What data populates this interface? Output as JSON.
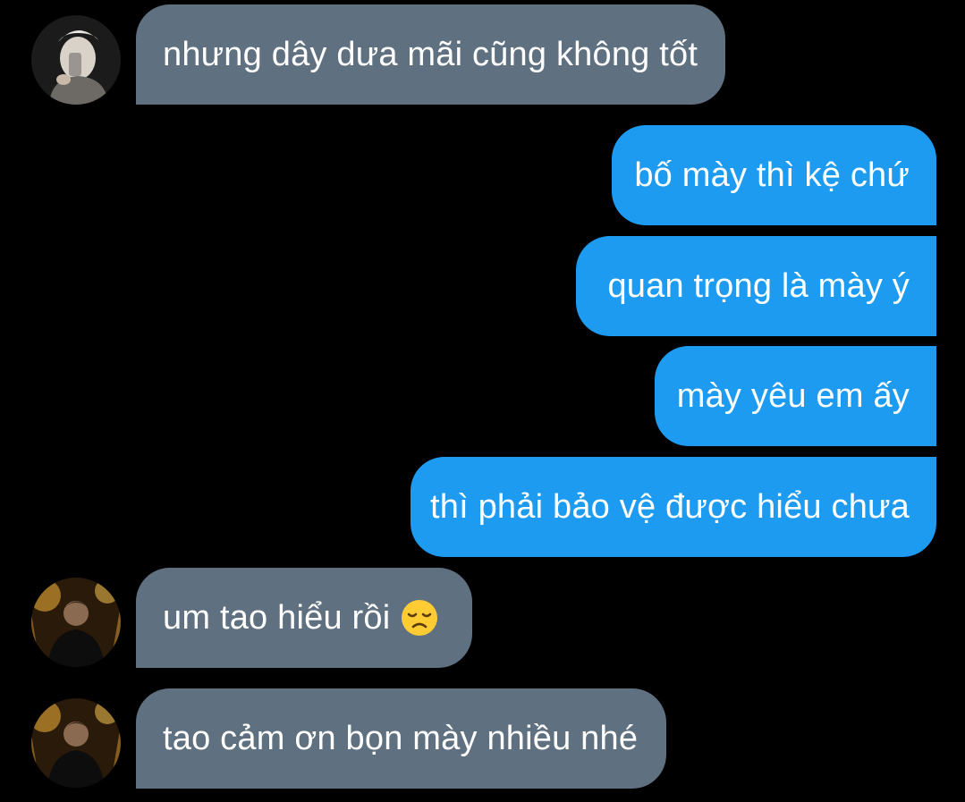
{
  "messages": [
    {
      "direction": "incoming",
      "text": "nhưng dây dưa mãi cũng không tốt"
    },
    {
      "direction": "outgoing",
      "text": "bố mày thì kệ chứ"
    },
    {
      "direction": "outgoing",
      "text": "quan trọng là mày ý"
    },
    {
      "direction": "outgoing",
      "text": "mày yêu em ấy"
    },
    {
      "direction": "outgoing",
      "text": "thì phải bảo vệ được hiểu chưa"
    },
    {
      "direction": "incoming",
      "text": "um tao hiểu rồi",
      "emoji": "disappointed-face-emoji"
    },
    {
      "direction": "incoming",
      "text": "tao cảm ơn bọn mày nhiều nhé"
    }
  ],
  "colors": {
    "background": "#000000",
    "incoming_bubble": "#5f7080",
    "outgoing_bubble": "#1d9bf0",
    "text": "#ffffff"
  },
  "icons": {
    "avatar_1": "avatar-mirror-selfie",
    "avatar_2": "avatar-night-portrait",
    "avatar_3": "avatar-night-portrait"
  }
}
